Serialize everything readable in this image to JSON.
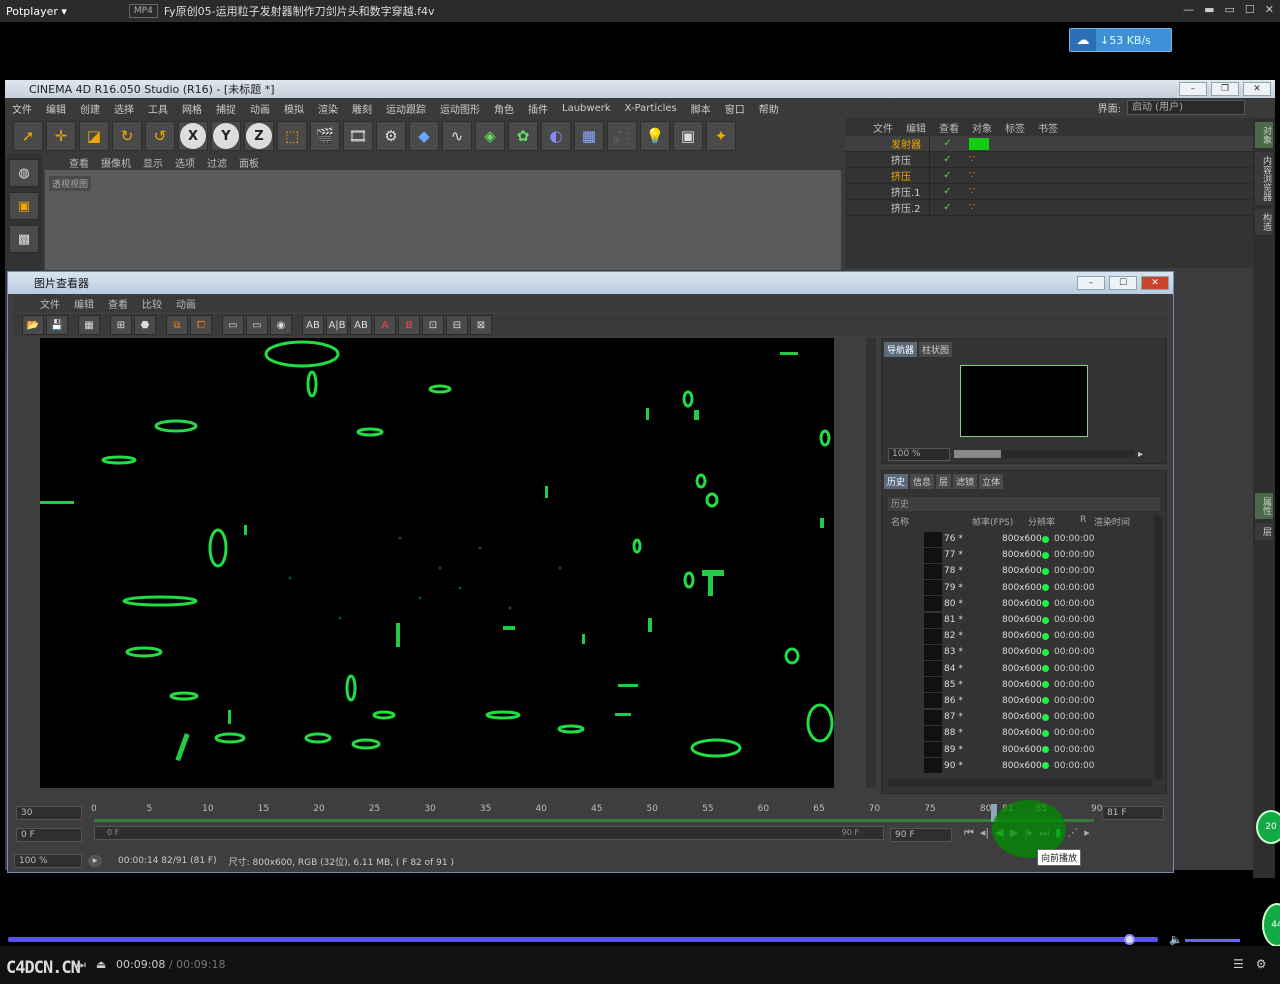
{
  "potplayer": {
    "brand": "Potplayer ▾",
    "format": "MP4",
    "file": "Fy原创05-运用粒子发射器制作刀剑片头和数字穿越.f4v",
    "net_speed": "↓53 KB/s",
    "time_current": "00:09:08",
    "time_total": " / 00:09:18",
    "logo": "C4DCN.CN",
    "gbtn1": "20",
    "gbtn2": "44"
  },
  "c4d": {
    "title": "CINEMA 4D R16.050 Studio (R16) - [未标题 *]",
    "menu": [
      "文件",
      "编辑",
      "创建",
      "选择",
      "工具",
      "网格",
      "捕捉",
      "动画",
      "模拟",
      "渲染",
      "雕刻",
      "运动跟踪",
      "运动图形",
      "角色",
      "插件",
      "Laubwerk",
      "X-Particles",
      "脚本",
      "窗口",
      "帮助"
    ],
    "layout_label": "界面:",
    "layout_value": "启动 (用户)",
    "viewport_menu": [
      "查看",
      "摄像机",
      "显示",
      "选项",
      "过滤",
      "面板"
    ],
    "viewport_label": "透视视图",
    "om_menu": [
      "文件",
      "编辑",
      "查看",
      "对象",
      "标签",
      "书签"
    ],
    "objects": [
      {
        "name": "发射器",
        "highlight": true
      },
      {
        "name": "挤压",
        "highlight": false
      },
      {
        "name": "挤压",
        "highlight": true
      },
      {
        "name": "挤压.1",
        "highlight": false
      },
      {
        "name": "挤压.2",
        "highlight": false
      }
    ],
    "right_tabs": [
      "对象",
      "内容浏览器",
      "构造"
    ],
    "right_tabs2": [
      "属性",
      "层"
    ]
  },
  "viewer": {
    "title": "图片查看器",
    "menu": [
      "文件",
      "编辑",
      "查看",
      "比较",
      "动画"
    ],
    "nav_tabs": [
      "导航器",
      "柱状图"
    ],
    "zoom": "100 %",
    "zoom_fraction": 0.26,
    "hist_tabs": [
      "历史",
      "信息",
      "层",
      "滤镜",
      "立体"
    ],
    "hist_label": "历史",
    "hist_cols": [
      "名称",
      "帧率(FPS)",
      "分辨率",
      "R",
      "渲染时间"
    ],
    "history": [
      {
        "n": "76 *",
        "res": "800x600",
        "t": "00:00:00"
      },
      {
        "n": "77 *",
        "res": "800x600",
        "t": "00:00:00"
      },
      {
        "n": "78 *",
        "res": "800x600",
        "t": "00:00:00"
      },
      {
        "n": "79 *",
        "res": "800x600",
        "t": "00:00:00"
      },
      {
        "n": "80 *",
        "res": "800x600",
        "t": "00:00:00"
      },
      {
        "n": "81 *",
        "res": "800x600",
        "t": "00:00:00"
      },
      {
        "n": "82 *",
        "res": "800x600",
        "t": "00:00:00"
      },
      {
        "n": "83 *",
        "res": "800x600",
        "t": "00:00:00"
      },
      {
        "n": "84 *",
        "res": "800x600",
        "t": "00:00:00"
      },
      {
        "n": "85 *",
        "res": "800x600",
        "t": "00:00:00"
      },
      {
        "n": "86 *",
        "res": "800x600",
        "t": "00:00:00"
      },
      {
        "n": "87 *",
        "res": "800x600",
        "t": "00:00:00"
      },
      {
        "n": "88 *",
        "res": "800x600",
        "t": "00:00:00"
      },
      {
        "n": "89 *",
        "res": "800x600",
        "t": "00:00:00"
      },
      {
        "n": "90 *",
        "res": "800x600",
        "t": "00:00:00"
      }
    ],
    "fps": "30",
    "start": "0 F",
    "range_start": "0 F",
    "range_end": "90 F",
    "end": "90 F",
    "current": "81 F",
    "ticks": [
      "0",
      "5",
      "10",
      "15",
      "20",
      "25",
      "30",
      "35",
      "40",
      "45",
      "50",
      "55",
      "60",
      "65",
      "70",
      "75",
      "80",
      "81",
      "85",
      "90"
    ],
    "playhead_frame": 81,
    "tooltip": "向前播放",
    "status_zoom": "100 %",
    "status_time": "00:00:14 82/91 (81 F)",
    "status_info": "尺寸: 800x600, RGB (32位), 6.11 MB, ( F 82 of 91 )"
  }
}
